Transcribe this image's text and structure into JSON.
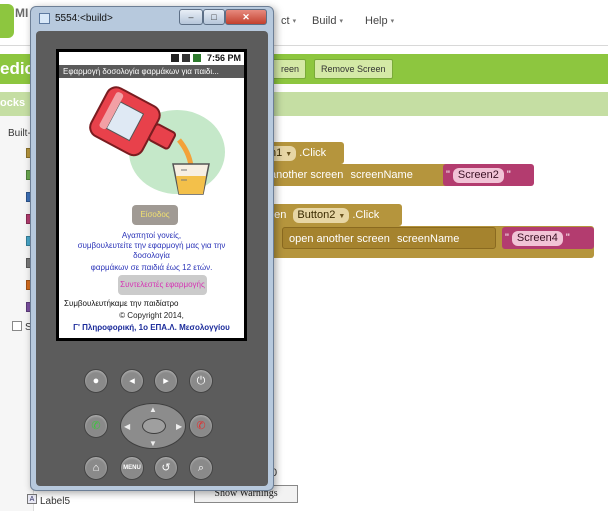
{
  "app": {
    "brand": "MI",
    "menus": [
      "ct",
      "Build",
      "Help"
    ],
    "project_name": "edic",
    "screen_button_fragment": "reen",
    "remove_screen_label": "Remove Screen",
    "panel_title": "ocks",
    "builtin_label": "Built-",
    "tree_checkbox_label": "S",
    "warning_count": "0",
    "show_warnings_label": "Show Warnings",
    "tree_last_item": "Label5"
  },
  "blocks": [
    {
      "event_prefix": "",
      "component_fragment": "n1",
      "event_label": ".Click",
      "call_label": "another screen",
      "param_label": "screenName",
      "value": "Screen2"
    },
    {
      "event_prefix": "hen",
      "component_fragment": "Button2",
      "event_label": ".Click",
      "call_label": "open another screen",
      "param_label": "screenName",
      "value": "Screen4"
    }
  ],
  "emulator": {
    "window_title": "5554:<build>",
    "window_buttons": [
      "minimize",
      "maximize",
      "close"
    ],
    "status_time": "7:56 PM",
    "app_title": "Εφαρμογή δοσολογία φαρμάκων για παιδι...",
    "btn_eisodos": "Είσοδος",
    "greeting_lines": [
      "Αγαπητοί γονείς,",
      "συμβουλευτείτε την εφαρμογή μας για την",
      "δοσολογία",
      "φαρμάκων σε παιδιά έως 12 ετών."
    ],
    "btn_collaborators": "Συντελεστές εφαρμογής",
    "pediatrician_text": "Συμβουλευτήκαμε την παιδίατρο",
    "copyright": "© Copyright 2014,",
    "author": "Γ' Πληροφορική, 1ο ΕΠΑ.Λ. Μεσολογγίου",
    "hardware_buttons": [
      "camera",
      "volume-down",
      "volume-up",
      "power",
      "call",
      "end-call",
      "home",
      "MENU",
      "back",
      "search"
    ],
    "dpad_center_label": ""
  },
  "colors": {
    "accent_green": "#8dc63f",
    "block_event": "#b5953d",
    "block_text": "#b33c6f"
  }
}
